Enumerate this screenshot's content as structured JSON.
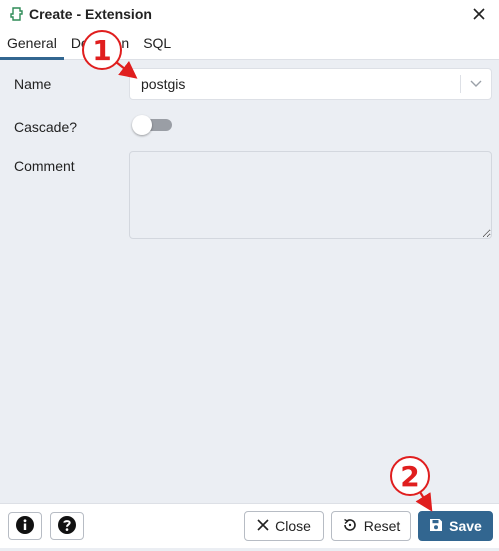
{
  "dialog": {
    "title": "Create - Extension"
  },
  "tabs": [
    {
      "label": "General",
      "active": true
    },
    {
      "label": "Definition",
      "active": false
    },
    {
      "label": "SQL",
      "active": false
    }
  ],
  "form": {
    "name_label": "Name",
    "name_value": "postgis",
    "cascade_label": "Cascade?",
    "cascade_on": false,
    "comment_label": "Comment",
    "comment_value": ""
  },
  "footer": {
    "close_label": "Close",
    "reset_label": "Reset",
    "save_label": "Save"
  },
  "annotations": {
    "step1": "1",
    "step2": "2"
  },
  "colors": {
    "accent": "#326690",
    "panel_bg": "#ebeef3",
    "callout_red": "#e01e1e"
  },
  "icons": [
    "extension-icon",
    "close-icon",
    "chevron-down-icon",
    "info-icon",
    "help-icon",
    "close-x-icon",
    "reset-icon",
    "save-icon"
  ]
}
